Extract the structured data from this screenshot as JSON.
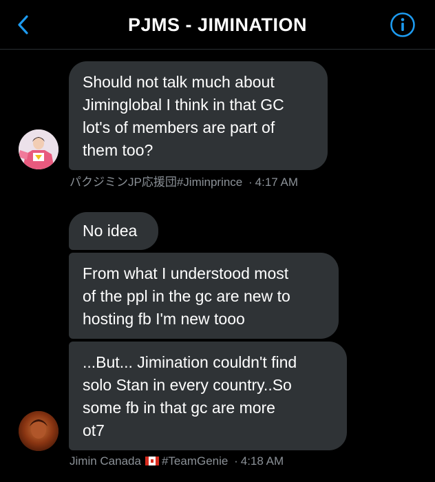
{
  "header": {
    "title": "PJMS - JIMINATION",
    "back_icon": "chevron-left-icon",
    "info_icon": "info-icon",
    "accent_color": "#1d9bf0"
  },
  "messages": [
    {
      "lines": [
        "Should not talk much about",
        "Jiminglobal I think in that GC",
        "lot's of members are part of",
        "them too?"
      ]
    },
    {
      "lines": [
        "No idea"
      ]
    },
    {
      "lines": [
        "From what I understood most",
        "of the ppl in the gc are new to",
        "hosting fb I'm new tooo"
      ]
    },
    {
      "lines": [
        "...But... Jimination couldn't find",
        "solo Stan in every country..So",
        "some fb in that gc are more",
        "ot7"
      ]
    }
  ],
  "senders": [
    {
      "name": "パクジミンJP応援団#Jiminprince",
      "time": "4:17 AM",
      "dot": "·"
    },
    {
      "name": "Jimin Canada",
      "flag": "🇨🇦",
      "tag": "#TeamGenie",
      "time": "4:18 AM",
      "dot": "·"
    }
  ],
  "colors": {
    "background": "#000000",
    "bubble": "#2f3336",
    "meta_text": "#8b9197"
  }
}
